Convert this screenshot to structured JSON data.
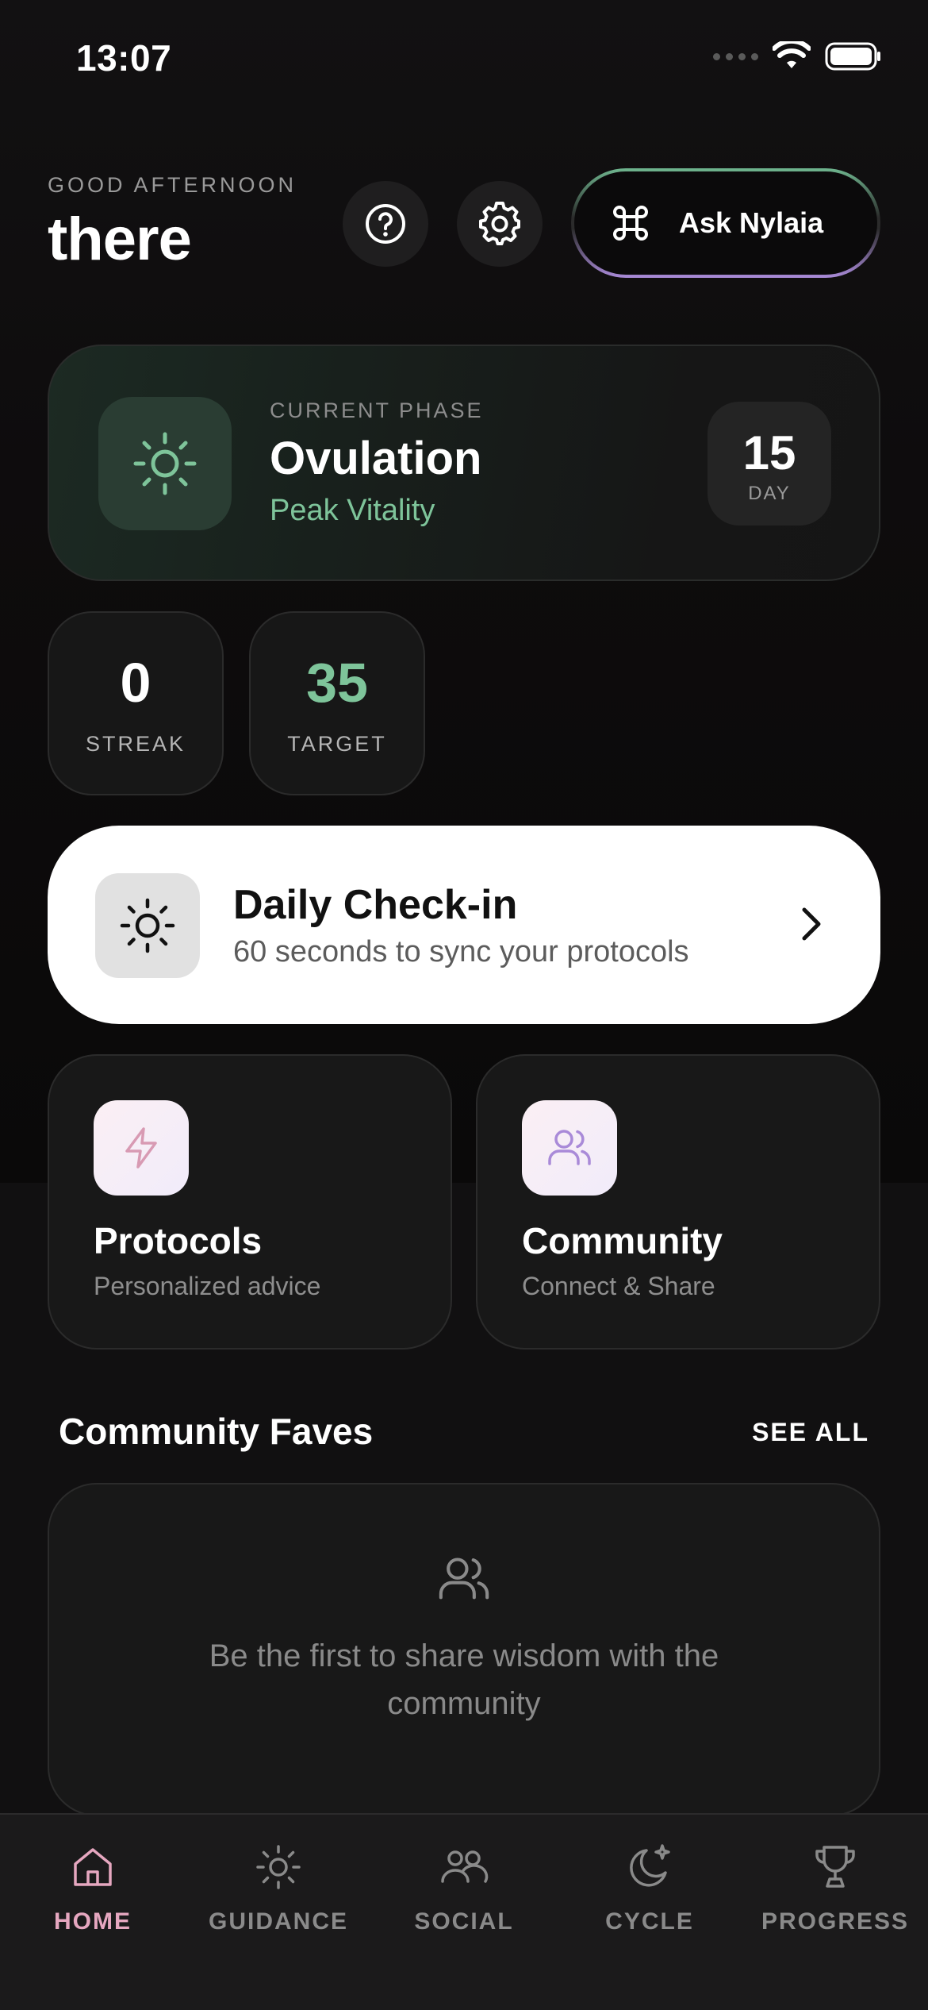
{
  "status_bar": {
    "time": "13:07"
  },
  "header": {
    "greeting": "GOOD AFTERNOON",
    "name": "there",
    "ask_button_label": "Ask Nylaia"
  },
  "phase_card": {
    "label": "CURRENT PHASE",
    "phase": "Ovulation",
    "tagline": "Peak Vitality",
    "day_number": "15",
    "day_label": "DAY"
  },
  "stats": [
    {
      "value": "0",
      "label": "STREAK",
      "color": "#ffffff"
    },
    {
      "value": "35",
      "label": "TARGET",
      "color": "#7ec49a"
    }
  ],
  "checkin": {
    "title": "Daily Check-in",
    "subtitle": "60 seconds to sync your protocols"
  },
  "features": [
    {
      "title": "Protocols",
      "subtitle": "Personalized advice",
      "icon": "lightning-icon"
    },
    {
      "title": "Community",
      "subtitle": "Connect & Share",
      "icon": "users-icon"
    }
  ],
  "community_faves": {
    "title": "Community Faves",
    "see_all": "SEE ALL",
    "empty_text": "Be the first to share wisdom with the community"
  },
  "bottom_nav": [
    {
      "label": "HOME",
      "icon": "home-icon",
      "active": true
    },
    {
      "label": "GUIDANCE",
      "icon": "sun-icon",
      "active": false
    },
    {
      "label": "SOCIAL",
      "icon": "users-icon",
      "active": false
    },
    {
      "label": "CYCLE",
      "icon": "moon-icon",
      "active": false
    },
    {
      "label": "PROGRESS",
      "icon": "trophy-icon",
      "active": false
    }
  ],
  "colors": {
    "accent_green": "#7ec49a",
    "accent_pink": "#e6a7c0",
    "accent_purple": "#a98ad8",
    "background": "#0c0b0c"
  }
}
